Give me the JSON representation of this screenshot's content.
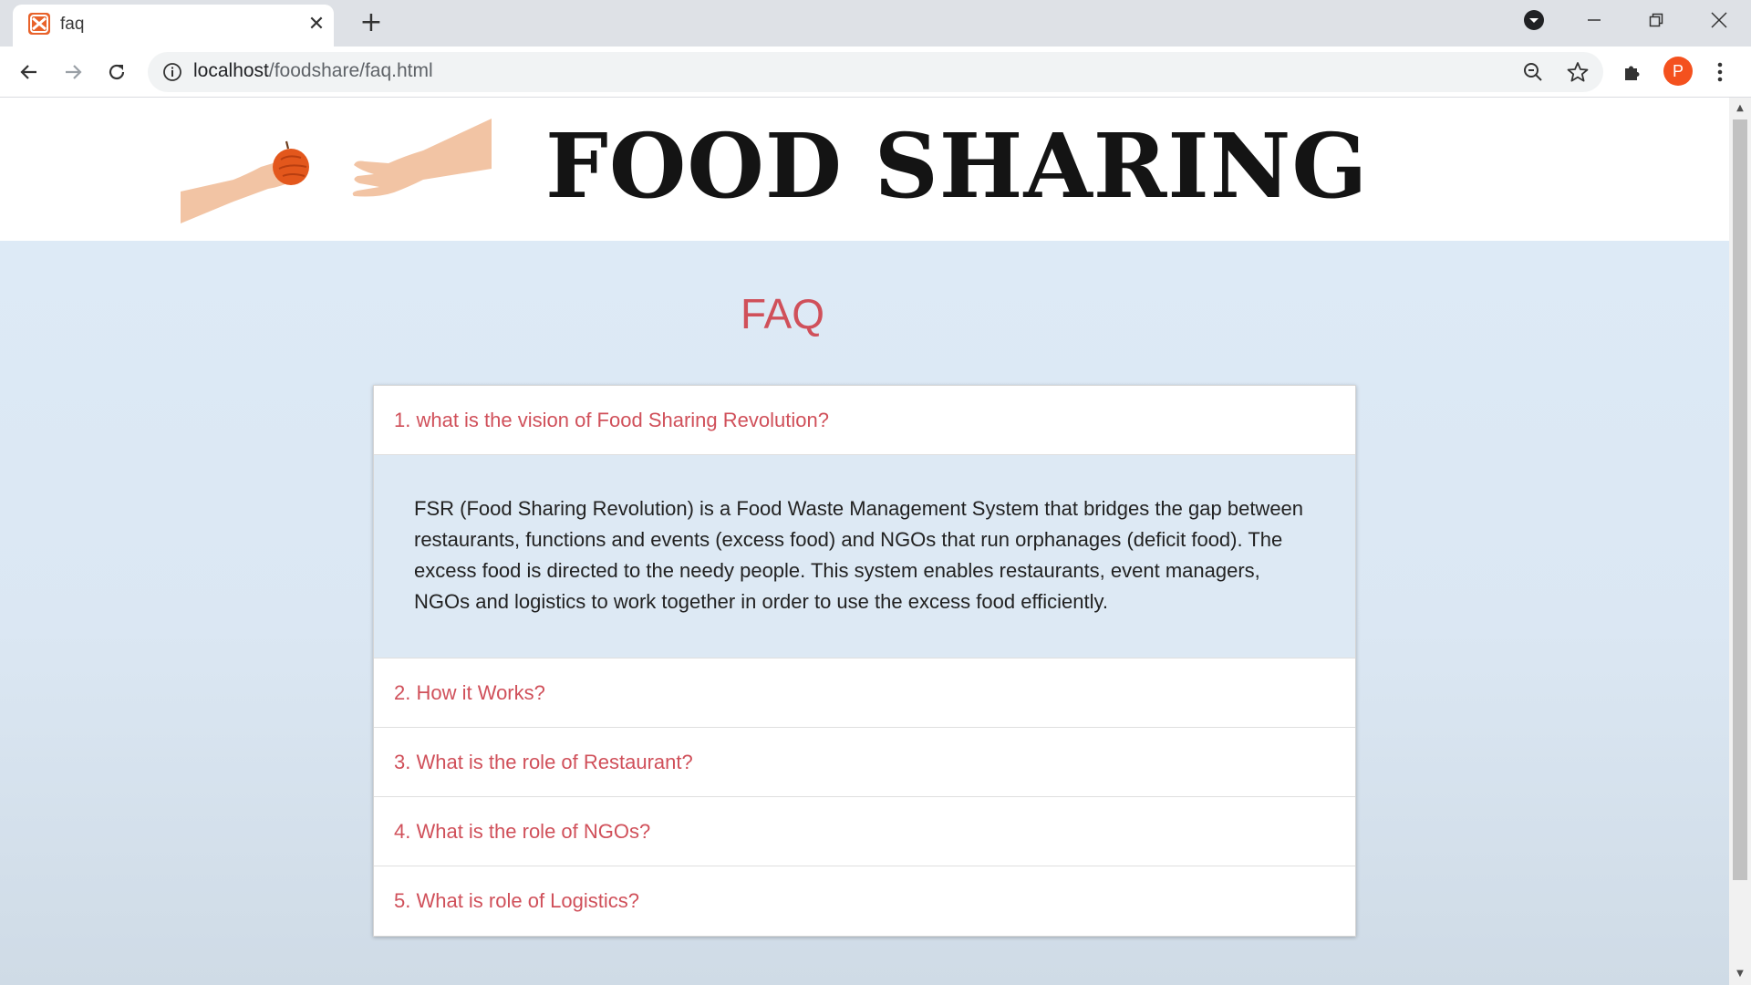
{
  "browser": {
    "tab_title": "faq",
    "url_host": "localhost",
    "url_path": "/foodshare/faq.html",
    "profile_initial": "P",
    "accent_color": "#f4511e"
  },
  "header": {
    "title": "FOOD SHARING"
  },
  "faq": {
    "heading": "FAQ",
    "items": [
      {
        "question": "1. what is the vision of Food Sharing Revolution?",
        "answer": "FSR (Food Sharing Revolution) is a Food Waste Management System that bridges the gap between restaurants, functions and events (excess food) and NGOs that run orphanages (deficit food). The excess food is directed to the needy people. This system enables restaurants, event managers, NGOs and logistics to work together in order to use the excess food efficiently."
      },
      {
        "question": "2. How it Works?"
      },
      {
        "question": "3. What is the role of Restaurant?"
      },
      {
        "question": "4. What is the role of NGOs?"
      },
      {
        "question": "5. What is role of Logistics?"
      }
    ]
  }
}
